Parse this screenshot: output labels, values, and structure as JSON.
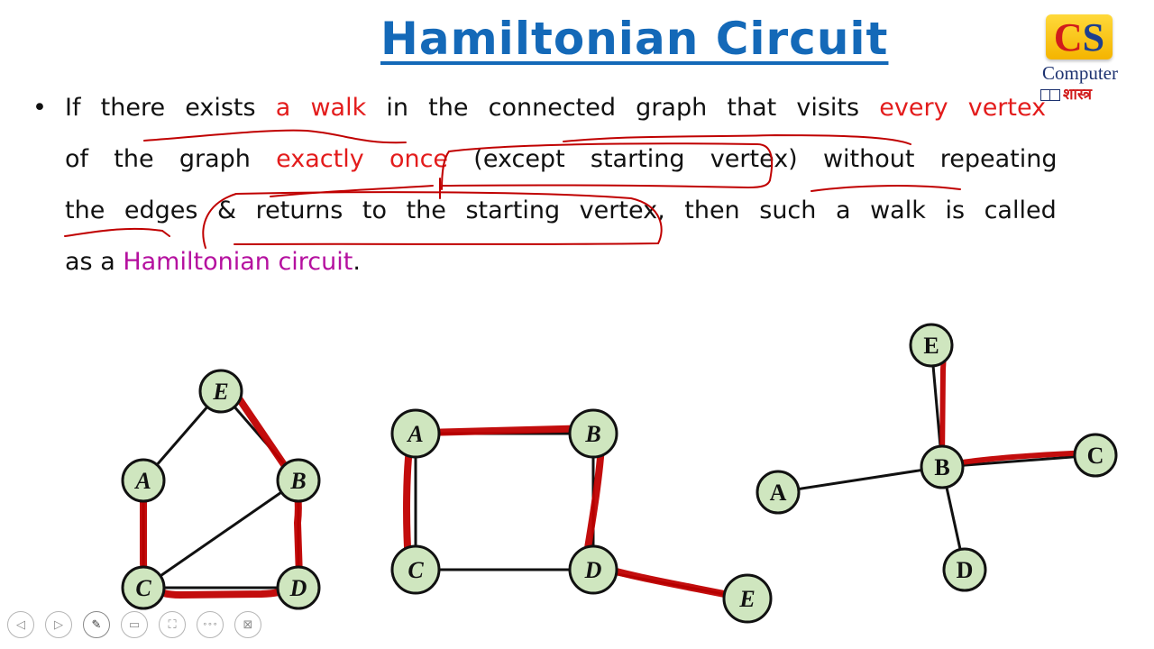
{
  "slide": {
    "title": "Hamiltonian Circuit",
    "logo": {
      "initial_c": "C",
      "initial_s": "S",
      "name": "Computer",
      "subtitle": "शास्त्र"
    },
    "bullet_symbol": "•",
    "definition": {
      "line1": [
        {
          "text": "If there exists ",
          "style": "normal"
        },
        {
          "text": "a walk",
          "style": "red"
        },
        {
          "text": " in the connected graph that visits ",
          "style": "normal"
        },
        {
          "text": "every vertex",
          "style": "red"
        }
      ],
      "line2": [
        {
          "text": "of the graph ",
          "style": "normal"
        },
        {
          "text": "exactly once",
          "style": "red"
        },
        {
          "text": " (except starting vertex) without repeating",
          "style": "normal"
        }
      ],
      "line3": [
        {
          "text": "the edges & returns to the starting vertex, then such a walk is called",
          "style": "normal"
        }
      ],
      "line4": [
        {
          "text": "as a ",
          "style": "normal"
        },
        {
          "text": "Hamiltonian circuit",
          "style": "magenta"
        },
        {
          "text": ".",
          "style": "normal"
        }
      ]
    },
    "colors": {
      "title": "#1469b8",
      "highlight_red": "#e31c1c",
      "highlight_magenta": "#b5109f",
      "node_fill": "#cfe6bf",
      "annotation_ink": "#c00000"
    }
  },
  "graphs": [
    {
      "id": "graph-1",
      "nodes": [
        {
          "label": "E",
          "italic": true
        },
        {
          "label": "A",
          "italic": true
        },
        {
          "label": "B",
          "italic": true
        },
        {
          "label": "C",
          "italic": true
        },
        {
          "label": "D",
          "italic": true
        }
      ],
      "edges": [
        [
          "E",
          "A"
        ],
        [
          "E",
          "B"
        ],
        [
          "A",
          "C"
        ],
        [
          "B",
          "C"
        ],
        [
          "B",
          "D"
        ],
        [
          "C",
          "D"
        ]
      ],
      "highlighted_path": [
        "A",
        "C",
        "D",
        "B",
        "E"
      ]
    },
    {
      "id": "graph-2",
      "nodes": [
        {
          "label": "A",
          "italic": true
        },
        {
          "label": "B",
          "italic": true
        },
        {
          "label": "C",
          "italic": true
        },
        {
          "label": "D",
          "italic": true
        },
        {
          "label": "E",
          "italic": true
        }
      ],
      "edges": [
        [
          "A",
          "B"
        ],
        [
          "A",
          "C"
        ],
        [
          "B",
          "D"
        ],
        [
          "C",
          "D"
        ],
        [
          "D",
          "E"
        ]
      ],
      "highlighted_path": [
        "C",
        "A",
        "B",
        "D",
        "E"
      ]
    },
    {
      "id": "graph-3",
      "nodes": [
        {
          "label": "E",
          "italic": false
        },
        {
          "label": "A",
          "italic": false
        },
        {
          "label": "B",
          "italic": false
        },
        {
          "label": "C",
          "italic": false
        },
        {
          "label": "D",
          "italic": false
        }
      ],
      "edges": [
        [
          "E",
          "B"
        ],
        [
          "A",
          "B"
        ],
        [
          "B",
          "C"
        ],
        [
          "B",
          "D"
        ]
      ],
      "highlighted_path": [
        "E",
        "B",
        "C"
      ]
    }
  ],
  "toolbar": {
    "buttons": [
      {
        "name": "previous-slide",
        "glyph": "◁"
      },
      {
        "name": "next-slide",
        "glyph": "▷"
      },
      {
        "name": "pen-tool",
        "glyph": "✎"
      },
      {
        "name": "subtitles",
        "glyph": "▭"
      },
      {
        "name": "zoom-slide",
        "glyph": "⛶"
      },
      {
        "name": "more-options",
        "glyph": "∘∘∘"
      },
      {
        "name": "end-show",
        "glyph": "⊠"
      }
    ]
  }
}
